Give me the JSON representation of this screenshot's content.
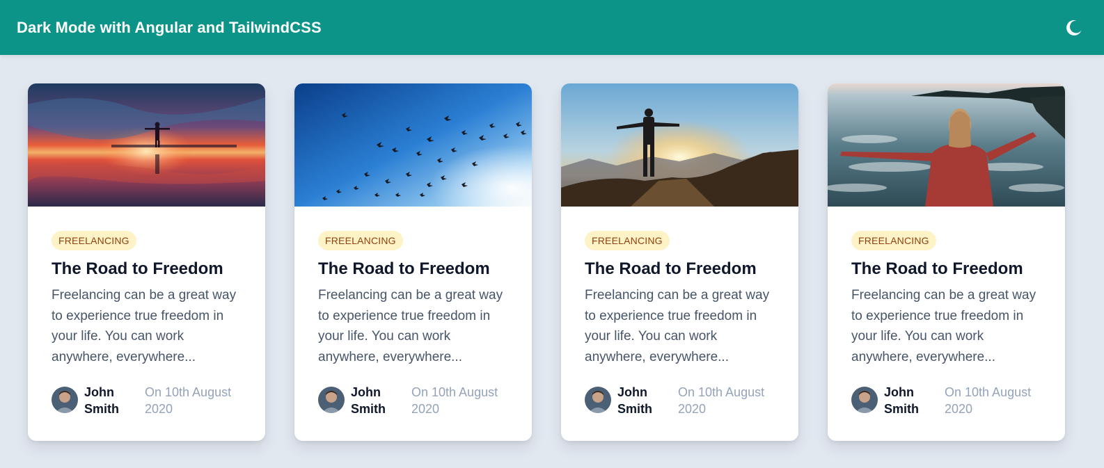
{
  "navbar": {
    "title": "Dark Mode with Angular and TailwindCSS",
    "toggle_icon": "moon-icon"
  },
  "colors": {
    "navbar_bg": "#0d9488",
    "page_bg": "#e2e8f0",
    "badge_bg": "#fef3c7",
    "badge_text": "#92400e"
  },
  "cards": [
    {
      "image": "sunset-reflection-person-photo",
      "category": "FREELANCING",
      "title": "The Road to Freedom",
      "excerpt": "Freelancing can be a great way to experience true freedom in your life. You can work anywhere, everywhere...",
      "author": "John Smith",
      "date": "On 10th August 2020"
    },
    {
      "image": "birds-in-blue-sky-photo",
      "category": "FREELANCING",
      "title": "The Road to Freedom",
      "excerpt": "Freelancing can be a great way to experience true freedom in your life. You can work anywhere, everywhere...",
      "author": "John Smith",
      "date": "On 10th August 2020"
    },
    {
      "image": "man-on-mountain-sunrise-photo",
      "category": "FREELANCING",
      "title": "The Road to Freedom",
      "excerpt": "Freelancing can be a great way to experience true freedom in your life. You can work anywhere, everywhere...",
      "author": "John Smith",
      "date": "On 10th August 2020"
    },
    {
      "image": "woman-by-sea-photo",
      "category": "FREELANCING",
      "title": "The Road to Freedom",
      "excerpt": "Freelancing can be a great way to experience true freedom in your life. You can work anywhere, everywhere...",
      "author": "John Smith",
      "date": "On 10th August 2020"
    }
  ]
}
